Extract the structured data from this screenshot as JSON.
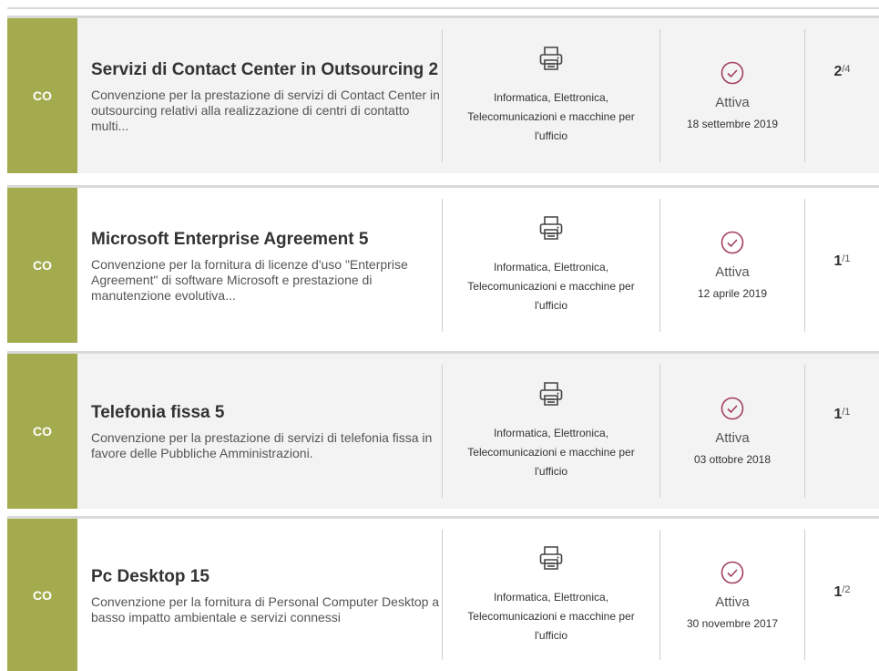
{
  "colors": {
    "badge": "#a3ab4e",
    "check": "#a23f5d"
  },
  "items": [
    {
      "badge": "CO",
      "title": "Servizi di Contact Center in Outsourcing 2",
      "description": "Convenzione per la prestazione di servizi di Contact Center in outsourcing relativi alla realizzazione di centri di contatto multi...",
      "category_icon": "printer-icon",
      "category": "Informatica, Elettronica, Telecomunicazioni e macchine per l'ufficio",
      "status_icon": "check-circle-icon",
      "status": "Attiva",
      "date": "18 settembre 2019",
      "count_current": "2",
      "count_total": "/4"
    },
    {
      "badge": "CO",
      "title": "Microsoft Enterprise Agreement 5",
      "description": "Convenzione per la fornitura di licenze d'uso \"Enterprise Agreement\" di software Microsoft e prestazione di manutenzione evolutiva...",
      "category_icon": "printer-icon",
      "category": "Informatica, Elettronica, Telecomunicazioni e macchine per l'ufficio",
      "status_icon": "check-circle-icon",
      "status": "Attiva",
      "date": "12 aprile 2019",
      "count_current": "1",
      "count_total": "/1"
    },
    {
      "badge": "CO",
      "title": "Telefonia fissa 5",
      "description": "Convenzione per la prestazione di servizi di telefonia fissa in favore delle Pubbliche Amministrazioni.",
      "category_icon": "printer-icon",
      "category": "Informatica, Elettronica, Telecomunicazioni e macchine per l'ufficio",
      "status_icon": "check-circle-icon",
      "status": "Attiva",
      "date": "03 ottobre 2018",
      "count_current": "1",
      "count_total": "/1"
    },
    {
      "badge": "CO",
      "title": "Pc Desktop 15",
      "description": "Convenzione per la fornitura di Personal Computer Desktop a basso impatto ambientale e servizi connessi",
      "category_icon": "printer-icon",
      "category": "Informatica, Elettronica, Telecomunicazioni e macchine per l'ufficio",
      "status_icon": "check-circle-icon",
      "status": "Attiva",
      "date": "30 novembre 2017",
      "count_current": "1",
      "count_total": "/2"
    }
  ]
}
